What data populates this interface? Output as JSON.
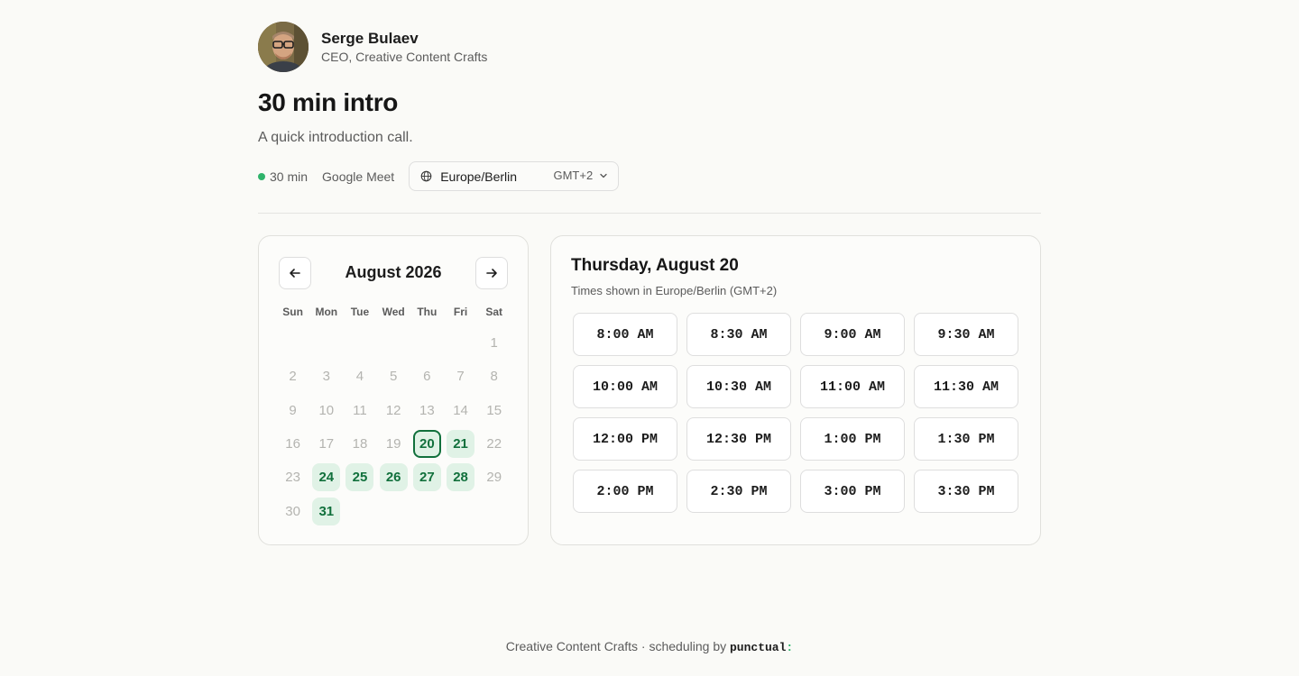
{
  "host": {
    "name": "Serge Bulaev",
    "role": "CEO, Creative Content Crafts"
  },
  "event": {
    "title": "30 min intro",
    "description": "A quick introduction call.",
    "duration": "30 min",
    "location": "Google Meet",
    "timezone": {
      "name": "Europe/Berlin",
      "offset": "GMT+2",
      "icon": "globe-icon"
    }
  },
  "calendar": {
    "month_label": "August 2026",
    "prev_icon": "arrow-left-icon",
    "next_icon": "arrow-right-icon",
    "weekdays": [
      "Sun",
      "Mon",
      "Tue",
      "Wed",
      "Thu",
      "Fri",
      "Sat"
    ],
    "leading_blanks": 6,
    "days": [
      {
        "d": "1",
        "state": "disabled"
      },
      {
        "d": "2",
        "state": "disabled"
      },
      {
        "d": "3",
        "state": "disabled"
      },
      {
        "d": "4",
        "state": "disabled"
      },
      {
        "d": "5",
        "state": "disabled"
      },
      {
        "d": "6",
        "state": "disabled"
      },
      {
        "d": "7",
        "state": "disabled"
      },
      {
        "d": "8",
        "state": "disabled"
      },
      {
        "d": "9",
        "state": "disabled"
      },
      {
        "d": "10",
        "state": "disabled"
      },
      {
        "d": "11",
        "state": "disabled"
      },
      {
        "d": "12",
        "state": "disabled"
      },
      {
        "d": "13",
        "state": "disabled"
      },
      {
        "d": "14",
        "state": "disabled"
      },
      {
        "d": "15",
        "state": "disabled"
      },
      {
        "d": "16",
        "state": "disabled"
      },
      {
        "d": "17",
        "state": "disabled"
      },
      {
        "d": "18",
        "state": "disabled"
      },
      {
        "d": "19",
        "state": "disabled"
      },
      {
        "d": "20",
        "state": "selected"
      },
      {
        "d": "21",
        "state": "available"
      },
      {
        "d": "22",
        "state": "disabled"
      },
      {
        "d": "23",
        "state": "disabled"
      },
      {
        "d": "24",
        "state": "available"
      },
      {
        "d": "25",
        "state": "available"
      },
      {
        "d": "26",
        "state": "available"
      },
      {
        "d": "27",
        "state": "available"
      },
      {
        "d": "28",
        "state": "available"
      },
      {
        "d": "29",
        "state": "disabled"
      },
      {
        "d": "30",
        "state": "disabled"
      },
      {
        "d": "31",
        "state": "available"
      }
    ]
  },
  "times": {
    "title": "Thursday, August 20",
    "subtitle": "Times shown in Europe/Berlin (GMT+2)",
    "slots": [
      "8:00 AM",
      "8:30 AM",
      "9:00 AM",
      "9:30 AM",
      "10:00 AM",
      "10:30 AM",
      "11:00 AM",
      "11:30 AM",
      "12:00 PM",
      "12:30 PM",
      "1:00 PM",
      "1:30 PM",
      "2:00 PM",
      "2:30 PM",
      "3:00 PM",
      "3:30 PM"
    ]
  },
  "footer": {
    "company": "Creative Content Crafts",
    "separator": " · scheduling by ",
    "brand": "punctual",
    "brand_mark": ":"
  },
  "colors": {
    "accent": "#2fb36b",
    "available_bg": "#e0f2e6",
    "available_text": "#11703c"
  }
}
